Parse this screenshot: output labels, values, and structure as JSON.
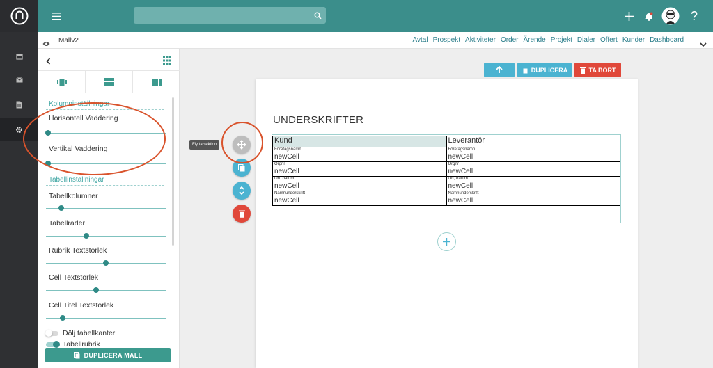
{
  "app": {
    "document_name": "Mallv2"
  },
  "topnav": {
    "links": [
      "Avtal",
      "Prospekt",
      "Aktiviteter",
      "Order",
      "Ärende",
      "Projekt",
      "Dialer",
      "Offert",
      "Kunder",
      "Dashboard"
    ]
  },
  "panel": {
    "column_settings_title": "Kolumninställningar",
    "horizontal_padding": "Horisontell Vaddering",
    "vertical_padding": "Vertikal Vaddering",
    "table_settings_title": "Tabellinställningar",
    "table_columns": "Tabellkolumner",
    "table_rows": "Tabellrader",
    "header_font_size": "Rubrik Textstorlek",
    "cell_font_size": "Cell Textstorlek",
    "cell_title_font_size": "Cell Titel Textstorlek",
    "hide_table_borders": "Dölj tabellkanter",
    "table_header": "Tabellrubrik",
    "duplicate_template": "DUPLICERA MALL",
    "slider_values": {
      "horizontal_padding": 0.02,
      "vertical_padding": 0.02,
      "table_columns": 0.13,
      "table_rows": 0.34,
      "header_font_size": 0.5,
      "cell_font_size": 0.42,
      "cell_title_font_size": 0.14
    },
    "toggles": {
      "hide_table_borders": false,
      "table_header": true
    }
  },
  "canvas": {
    "duplicate_label": "DUPLICERA",
    "delete_label": "TA BORT",
    "tooltip": "Flytta sektion",
    "heading": "UNDERSKRIFTER",
    "table": {
      "headers": [
        "Kund",
        "Leverantör"
      ],
      "rows": [
        {
          "title": "Företagsnamn",
          "value": "newCell"
        },
        {
          "title": "Orgnr",
          "value": "newCell"
        },
        {
          "title": "Ort, datum",
          "value": "newCell"
        },
        {
          "title": "Namnunderskrift",
          "value": "newCell"
        }
      ]
    }
  },
  "colors": {
    "topbar": "#3b8e8b",
    "accent": "#3aa3a0",
    "blue_button": "#4bb3d1",
    "red_button": "#e0483a",
    "annotation_ring": "#d9532c"
  },
  "icons": {
    "rail": [
      "logo-icon",
      "calendar-icon",
      "mail-icon",
      "document-icon",
      "gear-icon"
    ],
    "topbar": [
      "hamburger-icon",
      "search-icon",
      "plus-icon",
      "bell-icon",
      "avatar",
      "help-icon"
    ]
  }
}
